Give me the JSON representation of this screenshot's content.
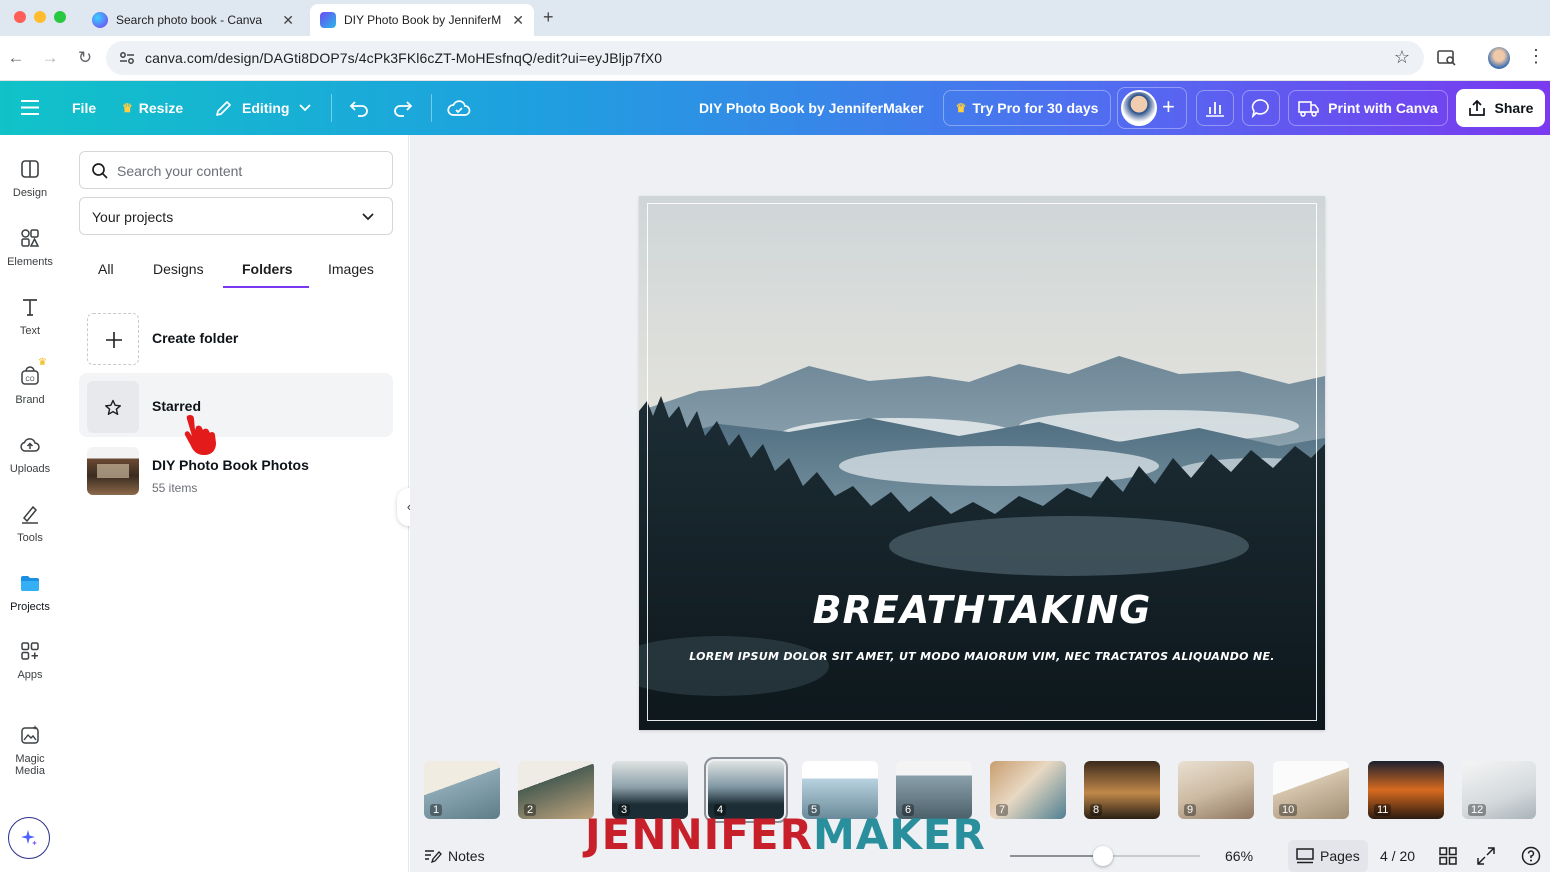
{
  "browser": {
    "tabs": [
      {
        "title": "Search photo book - Canva",
        "active": false
      },
      {
        "title": "DIY Photo Book by JenniferM",
        "active": true
      }
    ],
    "new_tab": "+",
    "url": "canva.com/design/DAGti8DOP7s/4cPk3FKl6cZT-MoHEsfnqQ/edit?ui=eyJBljp7fX0"
  },
  "header": {
    "file": "File",
    "resize": "Resize",
    "editing": "Editing",
    "design_title": "DIY Photo Book by JenniferMaker",
    "try_pro": "Try Pro for 30 days",
    "print": "Print with Canva",
    "share": "Share"
  },
  "rail": [
    {
      "label": "Design",
      "icon": "design-icon"
    },
    {
      "label": "Elements",
      "icon": "elements-icon"
    },
    {
      "label": "Text",
      "icon": "text-icon"
    },
    {
      "label": "Brand",
      "icon": "brand-icon"
    },
    {
      "label": "Uploads",
      "icon": "uploads-icon"
    },
    {
      "label": "Tools",
      "icon": "tools-icon"
    },
    {
      "label": "Projects",
      "icon": "projects-icon"
    },
    {
      "label": "Apps",
      "icon": "apps-icon"
    },
    {
      "label": "Magic Media",
      "icon": "magic-media-icon"
    }
  ],
  "panel": {
    "search_placeholder": "Search your content",
    "dropdown_value": "Your projects",
    "tabs": [
      "All",
      "Designs",
      "Folders",
      "Images"
    ],
    "active_tab": "Folders",
    "folders": [
      {
        "name": "Create folder",
        "sub": ""
      },
      {
        "name": "Starred",
        "sub": ""
      },
      {
        "name": "DIY Photo Book Photos",
        "sub": "55 items"
      }
    ]
  },
  "canvas": {
    "headline": "BREATHTAKING",
    "body": "LOREM IPSUM DOLOR SIT AMET, UT MODO MAIORUM VIM, NEC TRACTATOS ALIQUANDO NE."
  },
  "thumbnails": [
    {
      "n": "1"
    },
    {
      "n": "2"
    },
    {
      "n": "3"
    },
    {
      "n": "4"
    },
    {
      "n": "5"
    },
    {
      "n": "6"
    },
    {
      "n": "7"
    },
    {
      "n": "8"
    },
    {
      "n": "9"
    },
    {
      "n": "10"
    },
    {
      "n": "11"
    },
    {
      "n": "12"
    }
  ],
  "footer": {
    "notes": "Notes",
    "zoom": "66%",
    "pages": "Pages",
    "page_count": "4 / 20",
    "zoom_fraction": 0.49
  },
  "watermark": {
    "part1": "JENNIFER",
    "part2": "MAKER"
  },
  "colors": {
    "accent": "#7a39f0",
    "header_start": "#10c3c8",
    "header_end": "#7a39f0",
    "watermark_red": "#c8202a",
    "watermark_teal": "#2a8f9c"
  }
}
